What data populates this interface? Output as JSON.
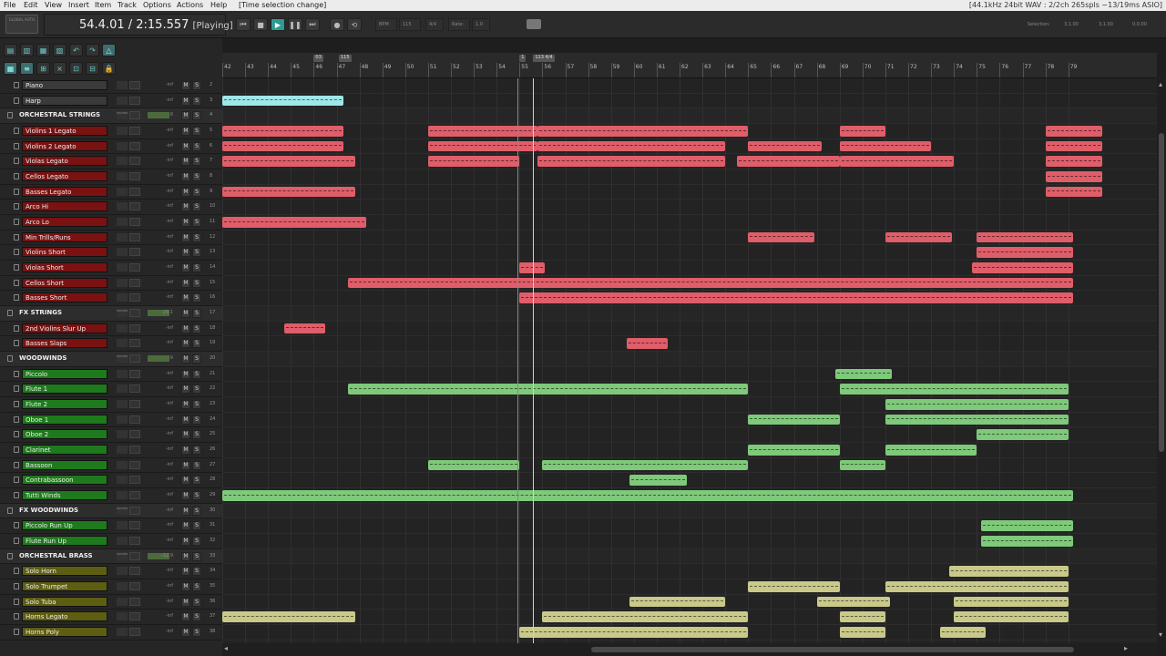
{
  "menu": {
    "items": [
      "File",
      "Edit",
      "View",
      "Insert",
      "Item",
      "Track",
      "Options",
      "Actions",
      "Help"
    ],
    "title_status": "[Time selection change]",
    "audio_status": "[44.1kHz 24bit WAV : 2/2ch 265spls ~13/19ms ASIO]"
  },
  "transport": {
    "logo": "GLOBAL AUTO",
    "position": "54.4.01 / 2:15.557",
    "state": "[Playing]",
    "bpm_label": "BPM",
    "bpm": "115",
    "time_sig": "4/4",
    "rate_label": "Rate:",
    "rate": "1.0",
    "selection_label": "Selection:",
    "sel_start": "3.1.00",
    "sel_end": "3.1.00",
    "sel_len": "0.0.00"
  },
  "ruler": {
    "bars": [
      "42",
      "43",
      "44",
      "45",
      "46",
      "47",
      "48",
      "49",
      "50",
      "51",
      "52",
      "53",
      "54",
      "55",
      "56",
      "57",
      "58",
      "59",
      "60",
      "61",
      "62",
      "63",
      "64",
      "65",
      "66",
      "67",
      "68",
      "69",
      "70",
      "71",
      "72",
      "73",
      "74",
      "75",
      "76",
      "77",
      "78",
      "79"
    ],
    "markers": [
      "03",
      "115",
      "1",
      "113 4/4"
    ]
  },
  "tracks": [
    {
      "name": "Piano",
      "folder": false,
      "color": "#3a3a3a",
      "num": "2",
      "vol": "-inf"
    },
    {
      "name": "Harp",
      "folder": false,
      "color": "#3a3a3a",
      "num": "3",
      "vol": "-inf"
    },
    {
      "name": "ORCHESTRAL STRINGS",
      "folder": true,
      "color": "#5a1515",
      "num": "4",
      "vol": "-9",
      "tag": "MASTER"
    },
    {
      "name": "Violins 1 Legato",
      "folder": false,
      "color": "#7a1212",
      "num": "5",
      "vol": "-inf"
    },
    {
      "name": "Violins 2 Legato",
      "folder": false,
      "color": "#7a1212",
      "num": "6",
      "vol": "-inf"
    },
    {
      "name": "Violas Legato",
      "folder": false,
      "color": "#7a1212",
      "num": "7",
      "vol": "-inf"
    },
    {
      "name": "Cellos Legato",
      "folder": false,
      "color": "#7a1212",
      "num": "8",
      "vol": "-inf"
    },
    {
      "name": "Basses Legato",
      "folder": false,
      "color": "#7a1212",
      "num": "9",
      "vol": "-inf"
    },
    {
      "name": "Arco Hi",
      "folder": false,
      "color": "#7a1212",
      "num": "10",
      "vol": "-inf"
    },
    {
      "name": "Arco Lo",
      "folder": false,
      "color": "#7a1212",
      "num": "11",
      "vol": "-inf"
    },
    {
      "name": "Min Trills/Runs",
      "folder": false,
      "color": "#7a1212",
      "num": "12",
      "vol": "-inf"
    },
    {
      "name": "Violins Short",
      "folder": false,
      "color": "#7a1212",
      "num": "13",
      "vol": "-inf"
    },
    {
      "name": "Violas Short",
      "folder": false,
      "color": "#7a1212",
      "num": "14",
      "vol": "-inf"
    },
    {
      "name": "Cellos Short",
      "folder": false,
      "color": "#7a1212",
      "num": "15",
      "vol": "-inf"
    },
    {
      "name": "Basses Short",
      "folder": false,
      "color": "#7a1212",
      "num": "16",
      "vol": "-inf"
    },
    {
      "name": "FX STRINGS",
      "folder": true,
      "color": "#5a1515",
      "num": "17",
      "vol": "-29.1",
      "tag": "MASTER"
    },
    {
      "name": "2nd Violins Slur Up",
      "folder": false,
      "color": "#7a1212",
      "num": "18",
      "vol": "-inf"
    },
    {
      "name": "Basses Slaps",
      "folder": false,
      "color": "#7a1212",
      "num": "19",
      "vol": "-inf"
    },
    {
      "name": "WOODWINDS",
      "folder": true,
      "color": "#1f5a1a",
      "num": "20",
      "vol": "-9",
      "tag": "MASTER"
    },
    {
      "name": "Piccolo",
      "folder": false,
      "color": "#1e7a1c",
      "num": "21",
      "vol": "-inf"
    },
    {
      "name": "Flute 1",
      "folder": false,
      "color": "#1e7a1c",
      "num": "22",
      "vol": "-inf"
    },
    {
      "name": "Flute 2",
      "folder": false,
      "color": "#1e7a1c",
      "num": "23",
      "vol": "-inf"
    },
    {
      "name": "Oboe 1",
      "folder": false,
      "color": "#1e7a1c",
      "num": "24",
      "vol": "-inf"
    },
    {
      "name": "Oboe 2",
      "folder": false,
      "color": "#1e7a1c",
      "num": "25",
      "vol": "-inf"
    },
    {
      "name": "Clarinet",
      "folder": false,
      "color": "#1e7a1c",
      "num": "26",
      "vol": "-inf"
    },
    {
      "name": "Bassoon",
      "folder": false,
      "color": "#1e7a1c",
      "num": "27",
      "vol": "-inf"
    },
    {
      "name": "Contrabassoon",
      "folder": false,
      "color": "#1e7a1c",
      "num": "28",
      "vol": "-inf"
    },
    {
      "name": "Tutti Winds",
      "folder": false,
      "color": "#1e7a1c",
      "num": "29",
      "vol": "-inf"
    },
    {
      "name": "FX WOODWINDS",
      "folder": true,
      "color": "#1f5a1a",
      "num": "30",
      "vol": "-inf",
      "tag": "MASTER"
    },
    {
      "name": "Piccolo Run Up",
      "folder": false,
      "color": "#1e7a1c",
      "num": "31",
      "vol": "-inf"
    },
    {
      "name": "Flute Run Up",
      "folder": false,
      "color": "#1e7a1c",
      "num": "32",
      "vol": "-inf"
    },
    {
      "name": "ORCHESTRAL BRASS",
      "folder": true,
      "color": "#4f4f1a",
      "num": "33",
      "vol": "-12.9",
      "tag": "MASTER"
    },
    {
      "name": "Solo Horn",
      "folder": false,
      "color": "#5e5e12",
      "num": "34",
      "vol": "-inf"
    },
    {
      "name": "Solo Trumpet",
      "folder": false,
      "color": "#5e5e12",
      "num": "35",
      "vol": "-inf"
    },
    {
      "name": "Solo Tuba",
      "folder": false,
      "color": "#5e5e12",
      "num": "36",
      "vol": "-inf"
    },
    {
      "name": "Horns Legato",
      "folder": false,
      "color": "#5e5e12",
      "num": "37",
      "vol": "-inf"
    },
    {
      "name": "Horns Poly",
      "folder": false,
      "color": "#5e5e12",
      "num": "38",
      "vol": "-inf"
    }
  ],
  "items": [
    {
      "track": 1,
      "start": 42.0,
      "end": 47.3,
      "color": "#9ee8e8"
    },
    {
      "track": 3,
      "start": 42.0,
      "end": 47.3,
      "color": "#e05d6a"
    },
    {
      "track": 3,
      "start": 51.0,
      "end": 55.8,
      "color": "#e05d6a"
    },
    {
      "track": 3,
      "start": 55.8,
      "end": 65.0,
      "color": "#e05d6a"
    },
    {
      "track": 3,
      "start": 69.0,
      "end": 71.0,
      "color": "#e05d6a"
    },
    {
      "track": 3,
      "start": 78.0,
      "end": 80.5,
      "color": "#e05d6a"
    },
    {
      "track": 4,
      "start": 42.0,
      "end": 47.3,
      "color": "#e05d6a"
    },
    {
      "track": 4,
      "start": 51.0,
      "end": 55.8,
      "color": "#e05d6a"
    },
    {
      "track": 4,
      "start": 55.8,
      "end": 64.0,
      "color": "#e05d6a"
    },
    {
      "track": 4,
      "start": 65.0,
      "end": 68.2,
      "color": "#e05d6a"
    },
    {
      "track": 4,
      "start": 69.0,
      "end": 73.0,
      "color": "#e05d6a"
    },
    {
      "track": 4,
      "start": 78.0,
      "end": 80.5,
      "color": "#e05d6a"
    },
    {
      "track": 5,
      "start": 42.0,
      "end": 47.8,
      "color": "#e05d6a"
    },
    {
      "track": 5,
      "start": 51.0,
      "end": 55.0,
      "color": "#e05d6a"
    },
    {
      "track": 5,
      "start": 55.8,
      "end": 64.0,
      "color": "#e05d6a"
    },
    {
      "track": 5,
      "start": 64.5,
      "end": 69.0,
      "color": "#e05d6a"
    },
    {
      "track": 5,
      "start": 69.0,
      "end": 74.0,
      "color": "#e05d6a"
    },
    {
      "track": 5,
      "start": 78.0,
      "end": 80.5,
      "color": "#e05d6a"
    },
    {
      "track": 6,
      "start": 78.0,
      "end": 80.5,
      "color": "#e05d6a"
    },
    {
      "track": 7,
      "start": 42.0,
      "end": 47.8,
      "color": "#e05d6a"
    },
    {
      "track": 7,
      "start": 78.0,
      "end": 80.5,
      "color": "#e05d6a"
    },
    {
      "track": 9,
      "start": 42.0,
      "end": 48.3,
      "color": "#e05d6a"
    },
    {
      "track": 10,
      "start": 65.0,
      "end": 67.9,
      "color": "#e05d6a"
    },
    {
      "track": 10,
      "start": 71.0,
      "end": 73.9,
      "color": "#e05d6a"
    },
    {
      "track": 10,
      "start": 75.0,
      "end": 79.2,
      "color": "#e05d6a"
    },
    {
      "track": 11,
      "start": 75.0,
      "end": 79.2,
      "color": "#e05d6a"
    },
    {
      "track": 12,
      "start": 55.0,
      "end": 56.1,
      "color": "#e05d6a"
    },
    {
      "track": 12,
      "start": 74.8,
      "end": 79.2,
      "color": "#e05d6a"
    },
    {
      "track": 13,
      "start": 47.5,
      "end": 79.2,
      "color": "#e05d6a"
    },
    {
      "track": 14,
      "start": 55.0,
      "end": 79.2,
      "color": "#e05d6a"
    },
    {
      "track": 16,
      "start": 44.7,
      "end": 46.5,
      "color": "#e05d6a"
    },
    {
      "track": 17,
      "start": 59.7,
      "end": 61.5,
      "color": "#e05d6a"
    },
    {
      "track": 19,
      "start": 68.8,
      "end": 71.3,
      "color": "#7ec97a"
    },
    {
      "track": 20,
      "start": 47.5,
      "end": 65.0,
      "color": "#7ec97a"
    },
    {
      "track": 20,
      "start": 69.0,
      "end": 79.0,
      "color": "#7ec97a"
    },
    {
      "track": 21,
      "start": 71.0,
      "end": 79.0,
      "color": "#7ec97a"
    },
    {
      "track": 22,
      "start": 65.0,
      "end": 69.0,
      "color": "#7ec97a"
    },
    {
      "track": 22,
      "start": 71.0,
      "end": 79.0,
      "color": "#7ec97a"
    },
    {
      "track": 23,
      "start": 75.0,
      "end": 79.0,
      "color": "#7ec97a"
    },
    {
      "track": 24,
      "start": 65.0,
      "end": 69.0,
      "color": "#7ec97a"
    },
    {
      "track": 24,
      "start": 71.0,
      "end": 75.0,
      "color": "#7ec97a"
    },
    {
      "track": 25,
      "start": 51.0,
      "end": 55.0,
      "color": "#7ec97a"
    },
    {
      "track": 25,
      "start": 56.0,
      "end": 65.0,
      "color": "#7ec97a"
    },
    {
      "track": 25,
      "start": 69.0,
      "end": 71.0,
      "color": "#7ec97a"
    },
    {
      "track": 26,
      "start": 59.8,
      "end": 62.3,
      "color": "#7ec97a"
    },
    {
      "track": 27,
      "start": 42.0,
      "end": 79.2,
      "color": "#7ec97a"
    },
    {
      "track": 29,
      "start": 75.2,
      "end": 79.2,
      "color": "#7ec97a"
    },
    {
      "track": 30,
      "start": 75.2,
      "end": 79.2,
      "color": "#7ec97a"
    },
    {
      "track": 32,
      "start": 73.8,
      "end": 79.0,
      "color": "#c9c98a"
    },
    {
      "track": 33,
      "start": 65.0,
      "end": 69.0,
      "color": "#c9c98a"
    },
    {
      "track": 33,
      "start": 71.0,
      "end": 79.0,
      "color": "#c9c98a"
    },
    {
      "track": 34,
      "start": 59.8,
      "end": 64.0,
      "color": "#c9c98a"
    },
    {
      "track": 34,
      "start": 68.0,
      "end": 71.2,
      "color": "#c9c98a"
    },
    {
      "track": 34,
      "start": 74.0,
      "end": 79.0,
      "color": "#c9c98a"
    },
    {
      "track": 35,
      "start": 42.0,
      "end": 47.8,
      "color": "#c9c98a"
    },
    {
      "track": 35,
      "start": 56.0,
      "end": 65.0,
      "color": "#c9c98a"
    },
    {
      "track": 35,
      "start": 69.0,
      "end": 71.0,
      "color": "#c9c98a"
    },
    {
      "track": 35,
      "start": 74.0,
      "end": 79.0,
      "color": "#c9c98a"
    },
    {
      "track": 36,
      "start": 55.0,
      "end": 65.0,
      "color": "#c9c98a"
    },
    {
      "track": 36,
      "start": 69.0,
      "end": 71.0,
      "color": "#c9c98a"
    },
    {
      "track": 36,
      "start": 73.4,
      "end": 75.4,
      "color": "#c9c98a"
    }
  ],
  "playhead_bar": 55.6,
  "selection_bar": 54.9
}
